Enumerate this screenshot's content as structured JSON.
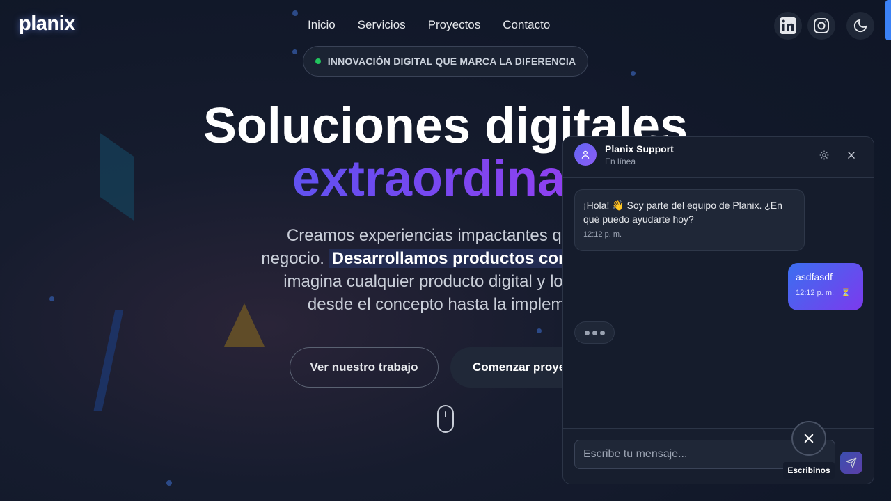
{
  "header": {
    "logo": "planix",
    "nav": [
      "Inicio",
      "Servicios",
      "Proyectos",
      "Contacto"
    ],
    "social_icons": [
      "linkedin-icon",
      "instagram-icon",
      "moon-icon"
    ]
  },
  "hero": {
    "badge": "INNOVACIÓN DIGITAL QUE MARCA LA DIFERENCIA",
    "title_line1": "Soluciones digitales",
    "title_line2": "extraordinari",
    "subtitle_part1": "Creamos experiencias impactantes que tra",
    "subtitle_part2": "negocio.",
    "subtitle_highlight": "Desarrollamos productos completam",
    "subtitle_part3": "imagina cualquier producto digital y lo const",
    "subtitle_part4": "desde el concepto hasta la implemen",
    "cta_secondary": "Ver nuestro trabajo",
    "cta_primary": "Comenzar proye"
  },
  "chat": {
    "title": "Planix Support",
    "status": "En línea",
    "incoming": {
      "text": "¡Hola! 👋 Soy parte del equipo de Planix. ¿En qué puedo ayudarte hoy?",
      "time": "12:12 p. m."
    },
    "outgoing": {
      "text": "asdfasdf",
      "time": "12:12 p. m.",
      "status_icon": "⏳"
    },
    "input_placeholder": "Escribe tu mensaje...",
    "toggle_label": "Escribinos"
  },
  "colors": {
    "background": "#111829",
    "accent_blue": "#3b6ff0",
    "accent_purple": "#7c3aed",
    "online_green": "#22c55e"
  }
}
